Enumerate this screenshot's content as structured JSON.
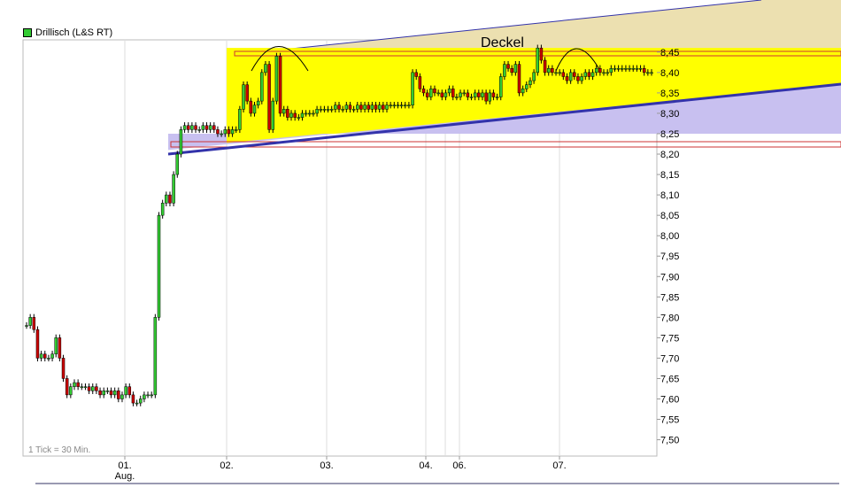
{
  "legend": {
    "label": "Drillisch (L&S RT)",
    "swatch_color": "#33cc33"
  },
  "footer_note": "1 Tick = 30 Min.",
  "annotation": "Deckel",
  "colors": {
    "up_candle": "#33cc33",
    "down_candle": "#cc0000",
    "resistance_zone": "#ffff00",
    "support_line": "#3333aa",
    "wedge_fill": "#c8c0f0",
    "upper_wedge_fill": "#ece0b0",
    "level_box": "#cc3333"
  },
  "chart_data": {
    "type": "candlestick",
    "title": "Drillisch (L&S RT)",
    "xlabel": "",
    "ylabel": "",
    "ylim": [
      7.46,
      8.48
    ],
    "y_ticks": [
      "8,45",
      "8,40",
      "8,35",
      "8,30",
      "8,25",
      "8,20",
      "8,15",
      "8,10",
      "8,05",
      "8,00",
      "7,95",
      "7,90",
      "7,85",
      "7,80",
      "7,75",
      "7,70",
      "7,65",
      "7,60",
      "7,55",
      "7,50"
    ],
    "x_ticks": [
      {
        "label": "01.",
        "sublabel": "Aug."
      },
      {
        "label": "02.",
        "sublabel": ""
      },
      {
        "label": "03.",
        "sublabel": ""
      },
      {
        "label": "04.",
        "sublabel": ""
      },
      {
        "label": "06.",
        "sublabel": ""
      },
      {
        "label": "07.",
        "sublabel": ""
      }
    ],
    "grid": true,
    "legend_position": "top-left",
    "resistance_zone": {
      "from": 8.25,
      "to": 8.46,
      "label": "Deckel"
    },
    "support_line": {
      "start": 8.21,
      "end": 8.39
    },
    "closes": [
      7.78,
      7.8,
      7.77,
      7.7,
      7.71,
      7.7,
      7.7,
      7.71,
      7.75,
      7.7,
      7.65,
      7.61,
      7.63,
      7.64,
      7.63,
      7.63,
      7.63,
      7.62,
      7.63,
      7.62,
      7.61,
      7.62,
      7.62,
      7.61,
      7.62,
      7.6,
      7.61,
      7.63,
      7.61,
      7.59,
      7.59,
      7.6,
      7.61,
      7.61,
      7.61,
      7.8,
      8.05,
      8.08,
      8.1,
      8.08,
      8.15,
      8.2,
      8.26,
      8.27,
      8.26,
      8.27,
      8.26,
      8.26,
      8.27,
      8.26,
      8.27,
      8.26,
      8.25,
      8.25,
      8.26,
      8.25,
      8.26,
      8.26,
      8.31,
      8.37,
      8.33,
      8.3,
      8.32,
      8.33,
      8.4,
      8.42,
      8.26,
      8.33,
      8.44,
      8.3,
      8.31,
      8.29,
      8.3,
      8.29,
      8.29,
      8.3,
      8.3,
      8.3,
      8.3,
      8.31,
      8.31,
      8.31,
      8.31,
      8.31,
      8.32,
      8.31,
      8.31,
      8.32,
      8.31,
      8.31,
      8.32,
      8.31,
      8.32,
      8.31,
      8.32,
      8.31,
      8.32,
      8.31,
      8.32,
      8.32,
      8.32,
      8.32,
      8.32,
      8.32,
      8.32,
      8.4,
      8.39,
      8.36,
      8.35,
      8.34,
      8.36,
      8.35,
      8.35,
      8.34,
      8.35,
      8.36,
      8.34,
      8.34,
      8.35,
      8.35,
      8.34,
      8.34,
      8.35,
      8.34,
      8.35,
      8.33,
      8.35,
      8.34,
      8.34,
      8.39,
      8.42,
      8.41,
      8.4,
      8.42,
      8.35,
      8.36,
      8.37,
      8.38,
      8.4,
      8.46,
      8.43,
      8.4,
      8.41,
      8.4,
      8.4,
      8.4,
      8.39,
      8.38,
      8.4,
      8.39,
      8.38,
      8.39,
      8.4,
      8.39,
      8.4,
      8.41,
      8.4,
      8.4,
      8.4,
      8.41,
      8.41,
      8.41,
      8.41,
      8.41,
      8.41,
      8.41,
      8.41,
      8.41,
      8.4,
      8.4,
      8.4
    ],
    "lows_hint": {
      "min": 7.54,
      "max": 8.46
    }
  }
}
